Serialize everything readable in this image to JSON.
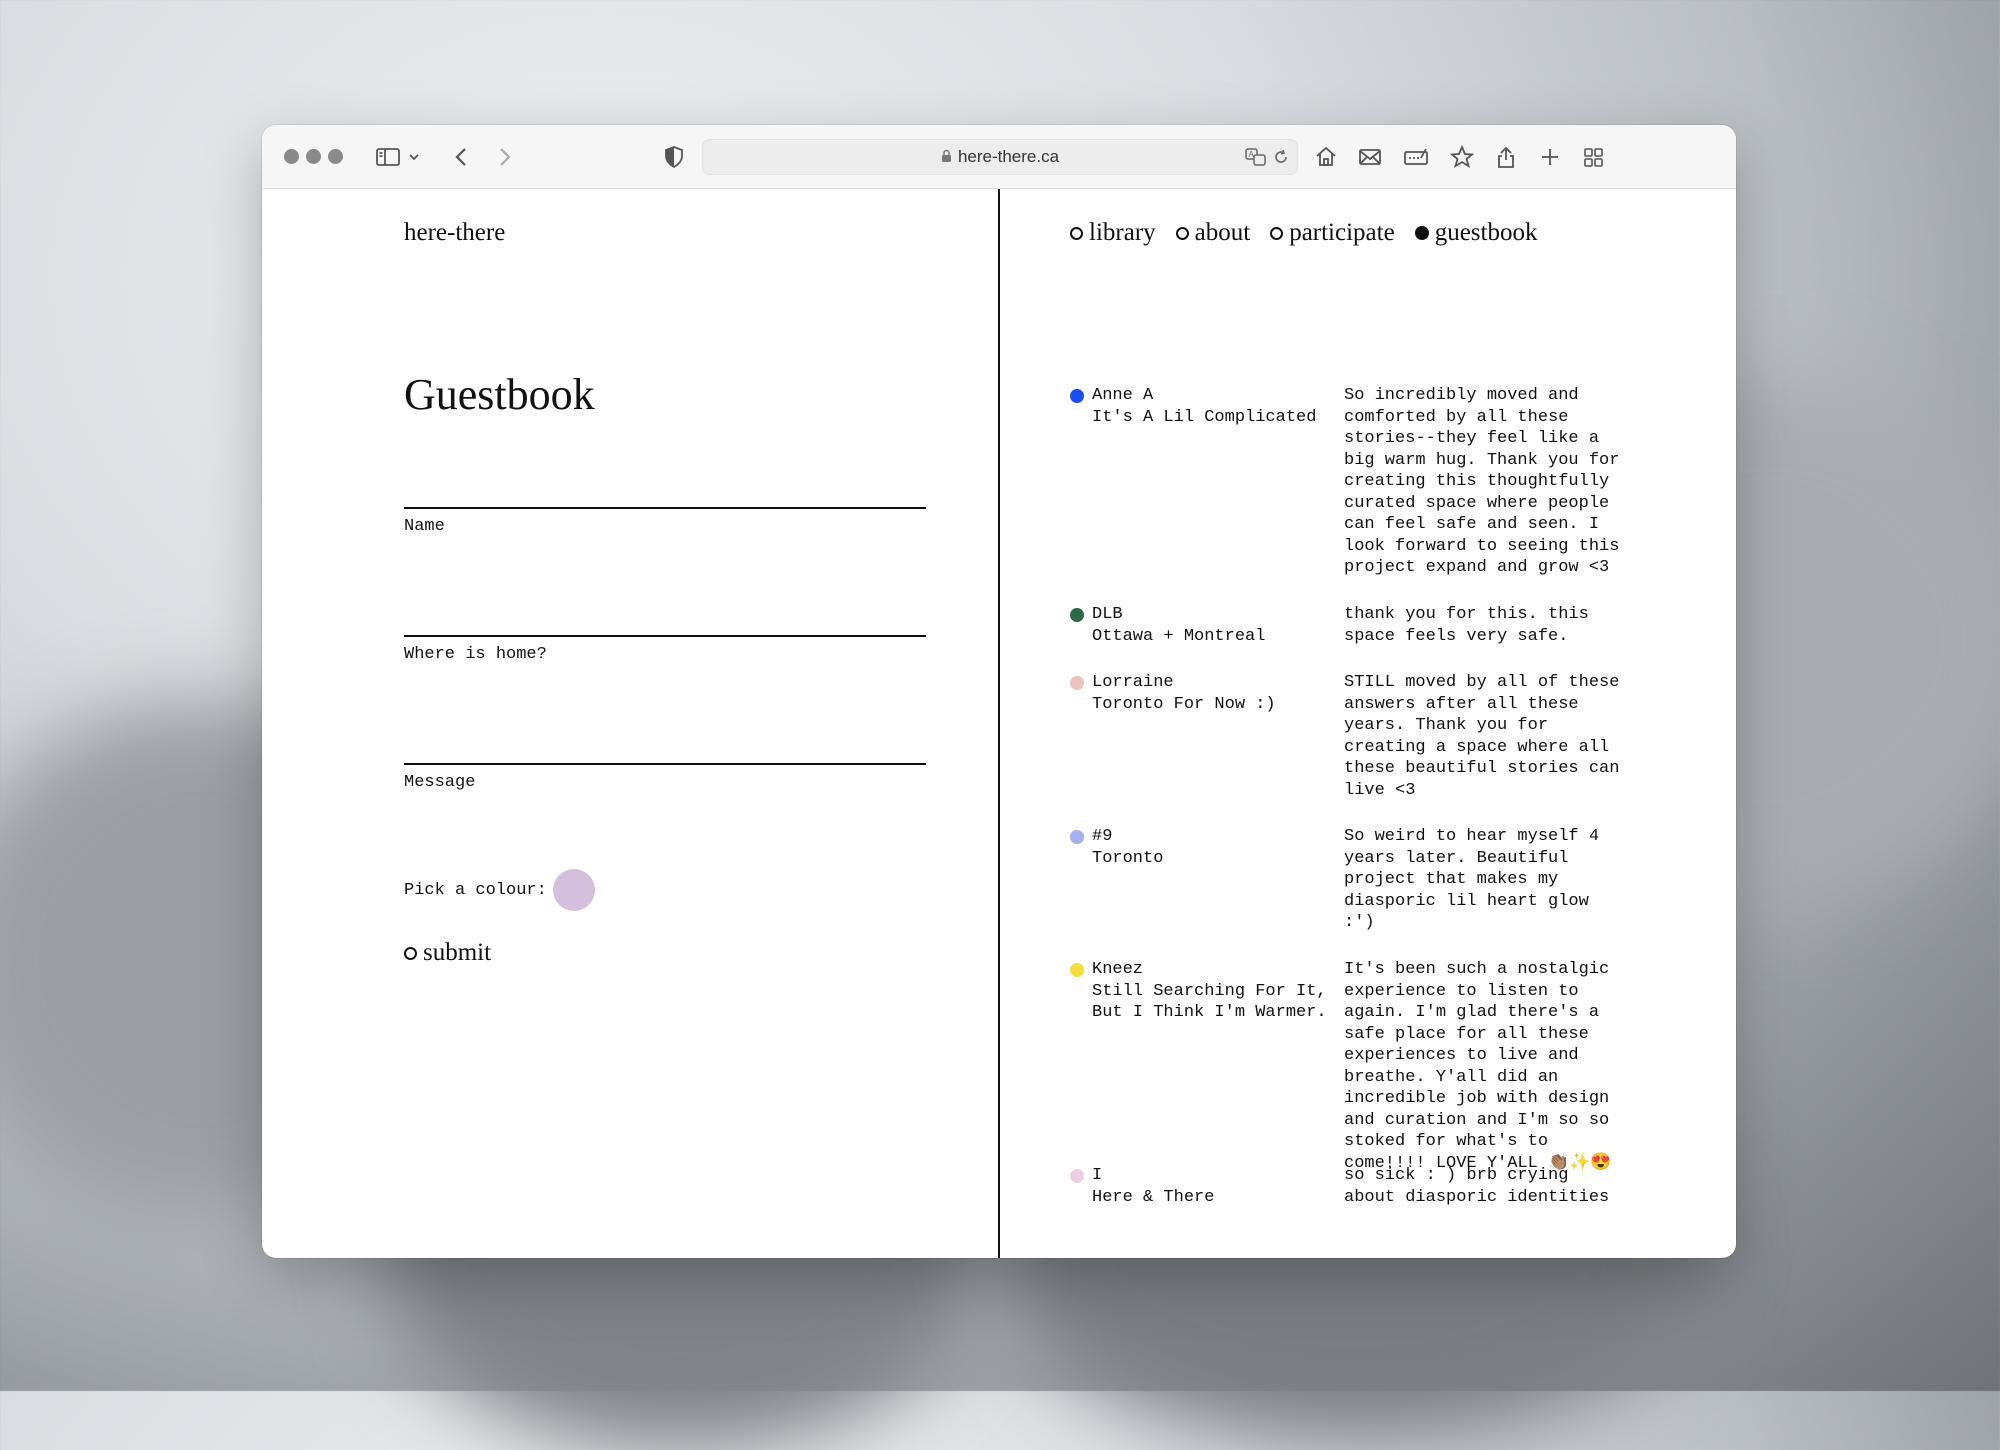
{
  "browser": {
    "url": "here-there.ca"
  },
  "site": {
    "brand": "here-there",
    "nav": [
      {
        "label": "library",
        "active": false
      },
      {
        "label": "about",
        "active": false
      },
      {
        "label": "participate",
        "active": false
      },
      {
        "label": "guestbook",
        "active": true
      }
    ]
  },
  "form": {
    "title": "Guestbook",
    "name_label": "Name",
    "home_label": "Where is home?",
    "message_label": "Message",
    "colour_label": "Pick a colour:",
    "colour_value": "#d4c0dd",
    "submit_label": "submit"
  },
  "entries": [
    {
      "name": "Anne A",
      "home": "It's A Lil Complicated",
      "colour": "#1f4ef0",
      "message": "So incredibly moved and\ncomforted by all these\nstories--they feel like a\nbig warm hug. Thank you for\ncreating this thoughtfully\ncurated space where people\ncan feel safe and seen. I\nlook forward to seeing this\nproject expand and grow <3"
    },
    {
      "name": "DLB",
      "home": "Ottawa + Montreal",
      "colour": "#2e6a45",
      "message": "thank you for this. this\nspace feels very safe."
    },
    {
      "name": "Lorraine",
      "home": "Toronto For Now :)",
      "colour": "#ecc2be",
      "message": "STILL moved by all of these\nanswers after all these\nyears. Thank you for\ncreating a space where all\nthese beautiful stories can\nlive <3"
    },
    {
      "name": "#9",
      "home": "Toronto",
      "colour": "#a6b0f2",
      "message": "So weird to hear myself 4\nyears later. Beautiful\nproject that makes my\ndiasporic lil heart glow\n:')"
    },
    {
      "name": "Kneez",
      "home": "Still Searching For It,\nBut I Think I'm Warmer.",
      "colour": "#f6dd3e",
      "message": "It's been such a nostalgic\nexperience to listen to\nagain. I'm glad there's a\nsafe place for all these\nexperiences to live and\nbreathe. Y'all did an\nincredible job with design\nand curation and I'm so so\nstoked for what's to\ncome!!!! LOVE Y'ALL 👏🏽✨😍"
    },
    {
      "name": "I",
      "home": "Here & There",
      "colour": "#eccfe4",
      "message": "so sick : ) brb crying\nabout diasporic identities"
    }
  ]
}
